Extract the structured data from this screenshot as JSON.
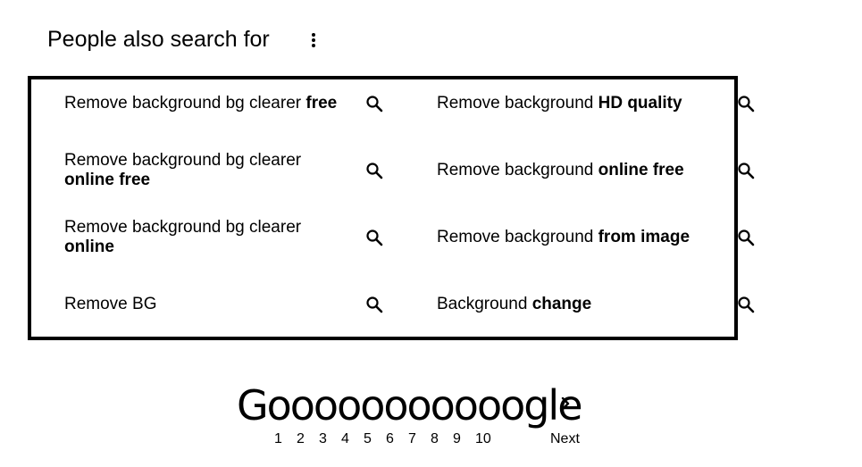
{
  "section": {
    "title": "People also search for",
    "more_icon": "vertical-dots-icon"
  },
  "related_searches": [
    {
      "text": "Remove background bg clearer ",
      "bold": "free",
      "icon": "search-icon"
    },
    {
      "text": "Remove background ",
      "bold": "HD quality",
      "icon": "search-icon"
    },
    {
      "text": "Remove background bg clearer ",
      "bold": "online free",
      "icon": "search-icon"
    },
    {
      "text": "Remove background ",
      "bold": "online free",
      "icon": "search-icon"
    },
    {
      "text": "Remove background bg clearer ",
      "bold": "online",
      "icon": "search-icon"
    },
    {
      "text": "Remove background ",
      "bold": "from image",
      "icon": "search-icon"
    },
    {
      "text": "Remove BG",
      "bold": "",
      "icon": "search-icon"
    },
    {
      "text": "Background ",
      "bold": "change",
      "icon": "search-icon"
    }
  ],
  "pagination": {
    "logo": "Gooooooooooogle",
    "pages": [
      "1",
      "2",
      "3",
      "4",
      "5",
      "6",
      "7",
      "8",
      "9",
      "10"
    ],
    "next_label": "Next",
    "next_icon": "chevron-right-icon"
  }
}
